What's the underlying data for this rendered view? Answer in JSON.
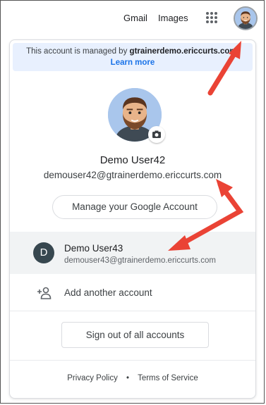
{
  "topbar": {
    "gmail_label": "Gmail",
    "images_label": "Images",
    "apps_icon": "apps-grid-icon",
    "account_icon": "avatar"
  },
  "notice": {
    "text": "This account is managed by",
    "domain": "gtrainerdemo.ericcurts.com.",
    "link": "Learn more"
  },
  "profile": {
    "name": "Demo User42",
    "email": "demouser42@gtrainerdemo.ericcurts.com",
    "manage_label": "Manage your Google Account",
    "camera_icon": "camera-icon"
  },
  "other_account": {
    "initial": "D",
    "name": "Demo User43",
    "email": "demouser43@gtrainerdemo.ericcurts.com"
  },
  "add_account": {
    "label": "Add another account",
    "icon": "add-person-icon"
  },
  "signout_label": "Sign out of all accounts",
  "footer": {
    "privacy": "Privacy Policy",
    "separator": "•",
    "terms": "Terms of Service"
  },
  "colors": {
    "accent": "#1a73e8",
    "notice_bg": "#e8f0fe",
    "arrow": "#ea4335",
    "selected_row": "#f1f3f4"
  }
}
